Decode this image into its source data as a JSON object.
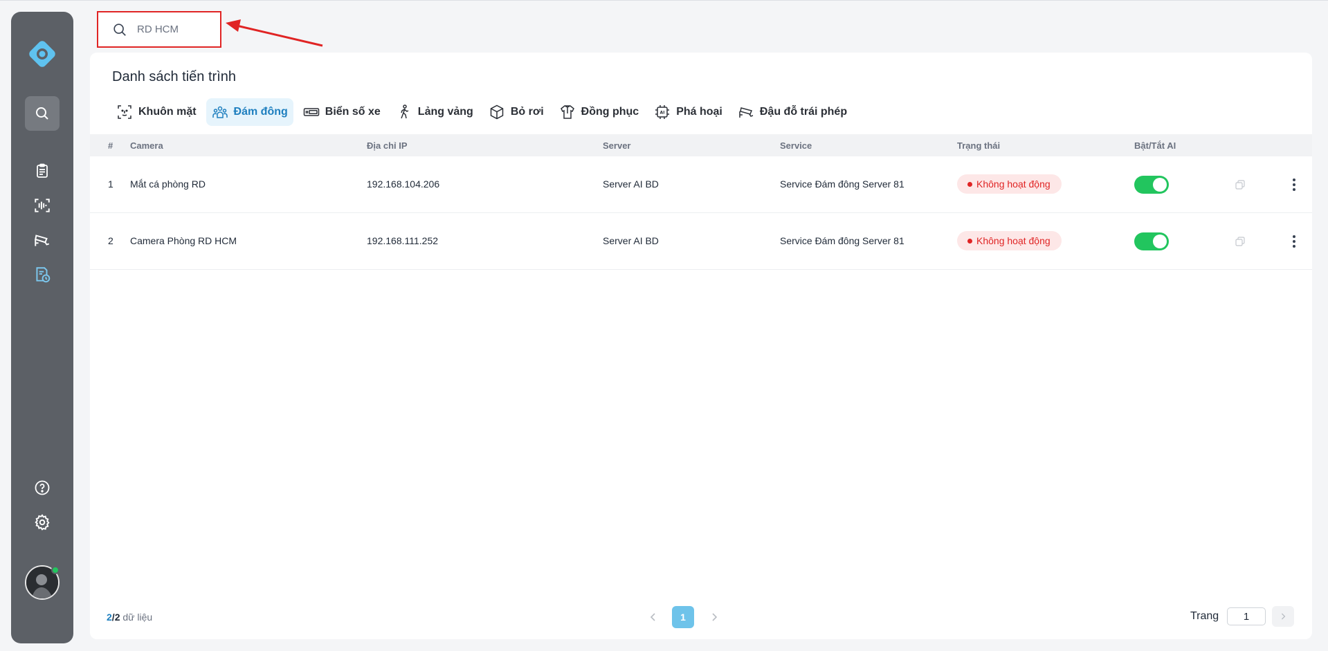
{
  "sidebar": {
    "items": [
      {
        "name": "search",
        "icon": "search-icon",
        "active": true
      },
      {
        "name": "clipboard",
        "icon": "clipboard-icon"
      },
      {
        "name": "scan",
        "icon": "face-scan-icon"
      },
      {
        "name": "camera",
        "icon": "cctv-camera-icon"
      },
      {
        "name": "report",
        "icon": "report-clock-icon"
      },
      {
        "name": "help",
        "icon": "help-icon"
      },
      {
        "name": "settings",
        "icon": "gear-icon"
      }
    ]
  },
  "search": {
    "value": "RD HCM",
    "placeholder": "RD HCM"
  },
  "panel": {
    "title": "Danh sách tiến trình"
  },
  "tabs": [
    {
      "label": "Khuôn mặt",
      "icon": "face-icon"
    },
    {
      "label": "Đám đông",
      "icon": "crowd-icon",
      "active": true
    },
    {
      "label": "Biển số xe",
      "icon": "license-plate-icon"
    },
    {
      "label": "Lảng vảng",
      "icon": "walking-person-icon"
    },
    {
      "label": "Bỏ rơi",
      "icon": "box-icon"
    },
    {
      "label": "Đồng phục",
      "icon": "shirt-icon"
    },
    {
      "label": "Phá hoại",
      "icon": "ai-chip-icon"
    },
    {
      "label": "Đậu đỗ trái phép",
      "icon": "cctv-camera-icon"
    }
  ],
  "table": {
    "columns": {
      "index": "#",
      "camera": "Camera",
      "ip": "Địa chỉ IP",
      "server": "Server",
      "service": "Service",
      "status": "Trạng thái",
      "ai": "Bật/Tắt AI"
    },
    "rows": [
      {
        "index": "1",
        "camera": "Mắt cá phòng RD",
        "ip": "192.168.104.206",
        "server": "Server AI BD",
        "service": "Service Đám đông Server 81",
        "status": "Không hoạt động",
        "ai_on": true
      },
      {
        "index": "2",
        "camera": "Camera Phòng RD HCM",
        "ip": "192.168.111.252",
        "server": "Server AI BD",
        "service": "Service Đám đông Server 81",
        "status": "Không hoạt động",
        "ai_on": true
      }
    ]
  },
  "footer": {
    "shown": "2",
    "separator": "/",
    "total": "2",
    "suffix": " dữ liệu",
    "current_page": "1",
    "page_label": "Trang",
    "page_input": "1"
  },
  "colors": {
    "accent": "#1e7fbf",
    "status_error": "#e02424",
    "toggle_on": "#22c55e",
    "sidebar": "#5c6066",
    "highlight_box": "#e02424"
  }
}
